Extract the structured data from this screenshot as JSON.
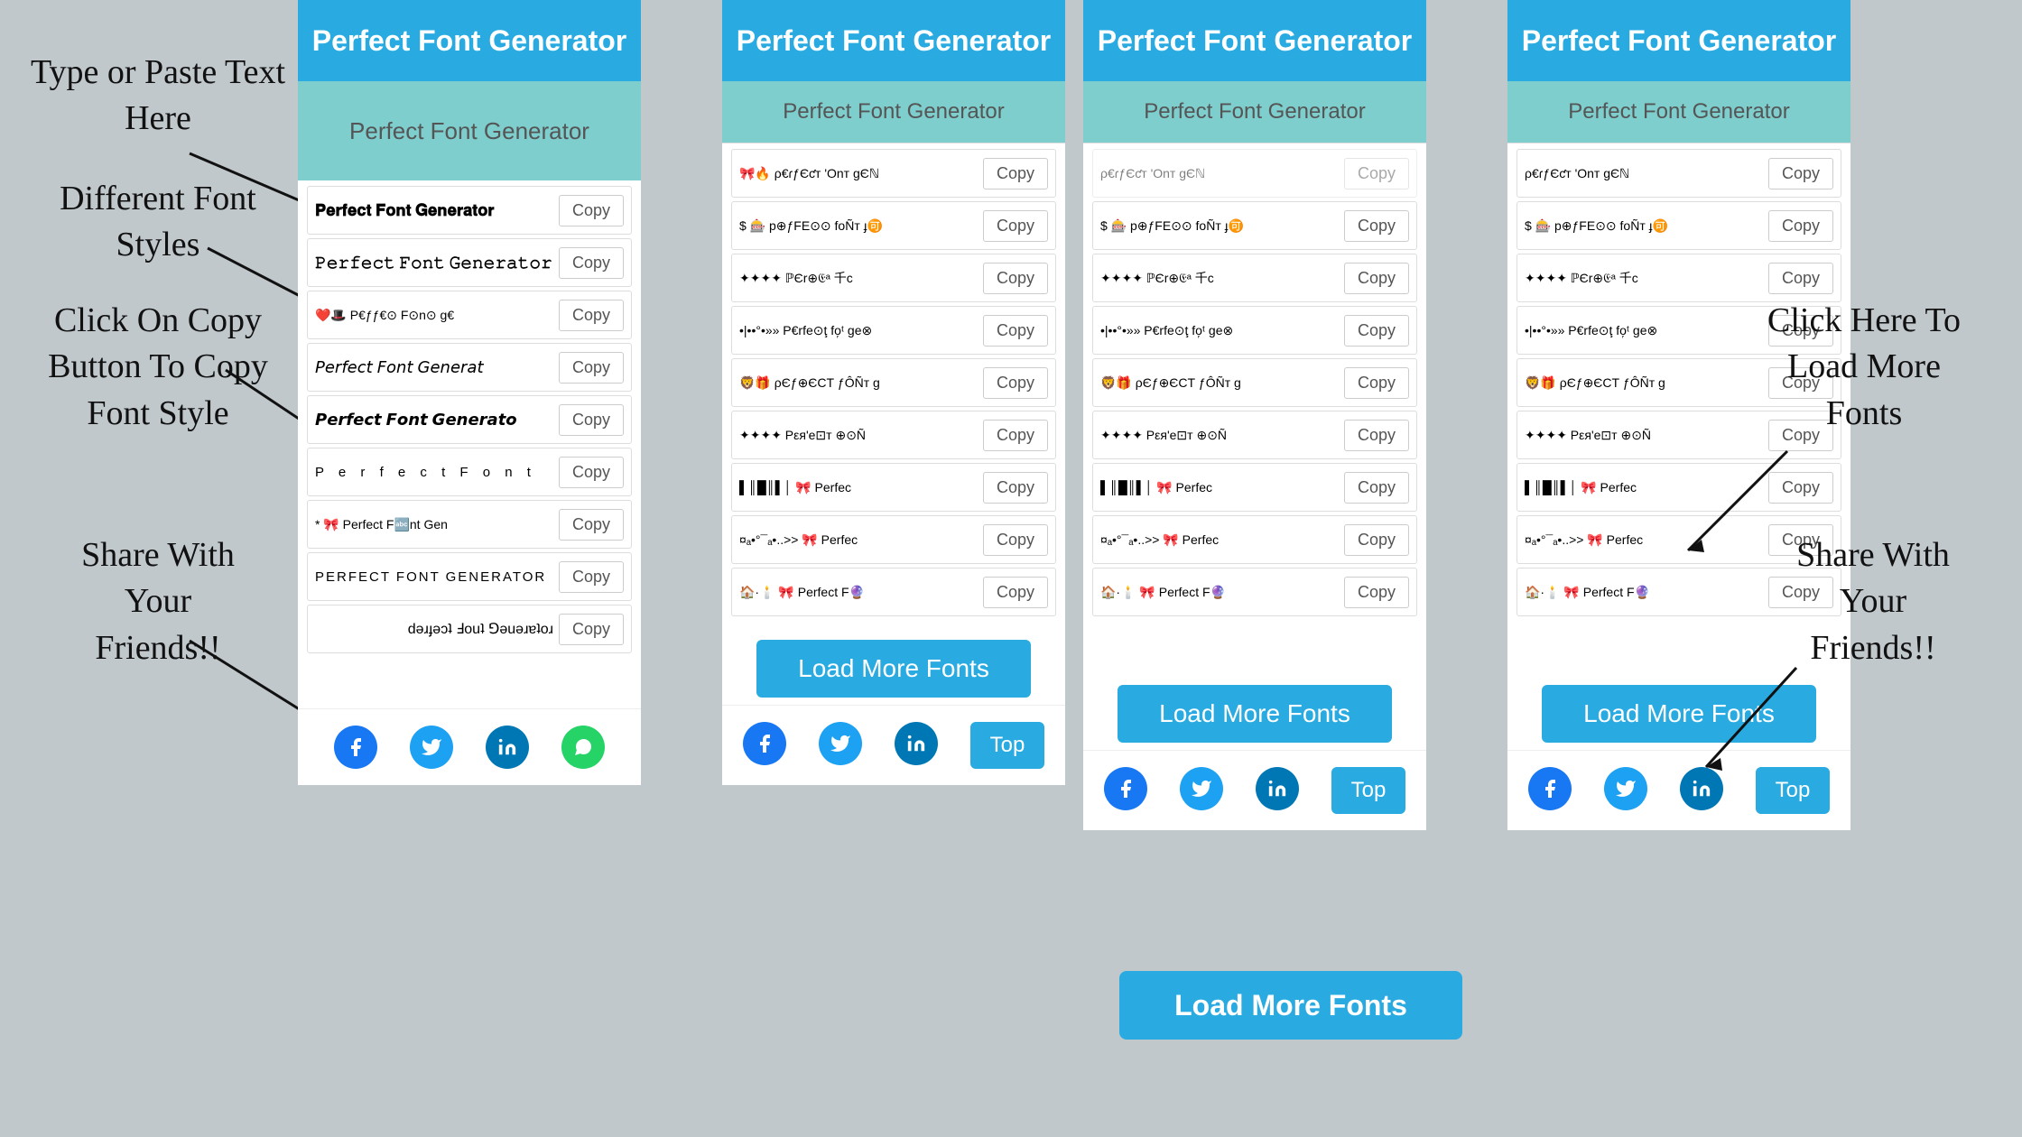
{
  "app": {
    "title": "Perfect Font Generator",
    "input_placeholder": "Perfect Font Generator",
    "input_value": "Perfect Font Generator"
  },
  "annotations": {
    "type_paste": "Type or Paste Text\nHere",
    "different_fonts": "Different Font\nStyles",
    "click_copy": "Click On Copy\nButton To Copy\nFont Style",
    "share": "Share With\nYour\nFriends!!",
    "load_more_label": "Click Here To\nLoad More\nFonts",
    "share_right": "Share With\nYour\nFriends!!"
  },
  "buttons": {
    "copy": "Copy",
    "load_more": "Load More Fonts",
    "top": "Top"
  },
  "font_rows_left": [
    {
      "text": "𝐏𝐞𝐫𝐟𝐞𝐜𝐭 𝐅𝐨𝐧𝐭 𝐆𝐞𝐧𝐞𝐫𝐚𝐭𝐨𝐫",
      "style": "f1"
    },
    {
      "text": "𝙿𝚎𝚛𝚏𝚎𝚌𝚝 𝙵𝚘𝚗𝚝 𝙶𝚎𝚗𝚎𝚛𝚊𝚝𝚘𝚛",
      "style": "f2"
    },
    {
      "text": "❤️🎩 P€ƒƒ€⊙ F⊙n⊙ g€",
      "style": "fx"
    },
    {
      "text": "𝘗𝘦𝘳𝘧𝘦𝘤𝘵 𝘍𝘰𝘯𝘵 𝘎𝘦𝘯𝘦𝘳𝘢𝘵",
      "style": "f4"
    },
    {
      "text": "𝙋𝙚𝙧𝙛𝙚𝙘𝙩 𝙁𝙤𝙣𝙩 𝙂𝙚𝙣𝙚𝙧𝙖𝙩𝙤",
      "style": "f5"
    },
    {
      "text": "P e r f e c t  F o n t",
      "style": "f6"
    },
    {
      "text": "* 🎀 Perfect F🔤nt Ger",
      "style": "fx"
    },
    {
      "text": "PERFECT FONT GENERATOR",
      "style": "f8"
    },
    {
      "text": "ɹoʇɐɹǝuǝ⅁ ʇuoℲ ʇɔǝɟɹǝd",
      "style": "f9"
    }
  ],
  "font_rows_right": [
    {
      "text": "ρ€ɾƒЄƈт 'Оnт gЄℕ",
      "style": "fx"
    },
    {
      "text": "$ 🎰 p⊕ƒFE⊙⊙ foÑт ɟ🉑",
      "style": "fx"
    },
    {
      "text": "✦✦✦✦ ℙЄr⊕𝔈ᵃ 千c",
      "style": "fx"
    },
    {
      "text": "•|••°•»» P€rfe⊙ţ fo᷊ᵗ ge⊗",
      "style": "fx"
    },
    {
      "text": "🦁🎁 ρЄƒ⊕ЄCТ ƒÔÑт g",
      "style": "fx"
    },
    {
      "text": "✦✦✦✦ Ρεя'е⊡т ⊕⊙Ñ",
      "style": "fx"
    },
    {
      "text": "▌║█║▌│ 🎀 Perfec",
      "style": "fx"
    },
    {
      "text": "¤ₐ•°¯ₐ•..>>  🎀 Perfec",
      "style": "fx"
    },
    {
      "text": "🏠·🕯️ 🎀 Perfect F🔮",
      "style": "fx"
    }
  ],
  "social": {
    "facebook": "f",
    "twitter": "t",
    "linkedin": "in",
    "whatsapp": "w"
  }
}
